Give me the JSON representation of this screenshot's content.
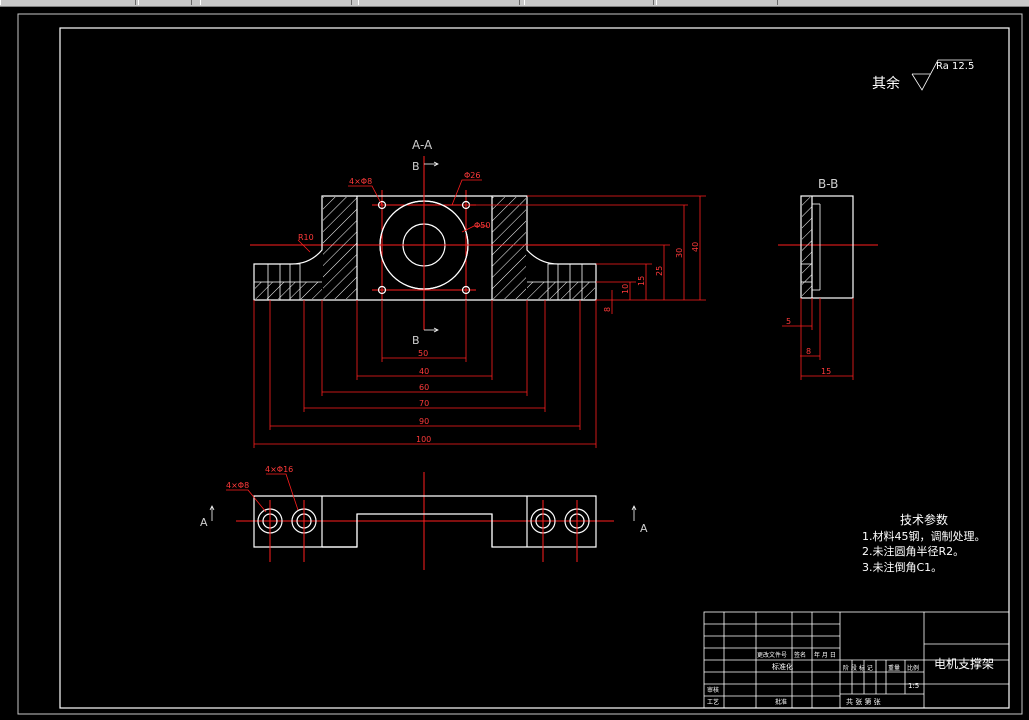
{
  "surface_finish": {
    "label": "其余",
    "ra": "Ra 12.5"
  },
  "section_labels": {
    "aa_title": "A-A",
    "bb_title": "B-B",
    "b_marker": "B",
    "a_marker": "A"
  },
  "front_dims": {
    "d1": "50",
    "d2": "40",
    "d3": "60",
    "d4": "70",
    "d5": "90",
    "d6": "100",
    "note_holes": "4×Φ8",
    "note_phi": "Φ26",
    "note_phi2": "Φ50",
    "note_r": "R10"
  },
  "right_dims": {
    "v1": "5",
    "v2": "8",
    "v3": "10",
    "v4": "15",
    "v5": "25",
    "v6": "30",
    "v7": "40"
  },
  "side_dims": {
    "s1": "5",
    "s2": "8",
    "s3": "15"
  },
  "plan_notes": {
    "n1": "4×Φ8",
    "n2": "4×Φ16"
  },
  "tech": {
    "title": "技术参数",
    "items": [
      "1.材料45钢，调制处理。",
      "2.未注圆角半径R2。",
      "3.未注倒角C1。"
    ]
  },
  "title_block": {
    "drawing_name": "电机支撑架",
    "r_change": "更改文件号",
    "r_sign": "签名",
    "r_date": "年 月 日",
    "r_standard": "标准化",
    "r_stage": "阶 段 标 记",
    "r_weight": "重量",
    "r_scale": "比例",
    "scale_val": "1:5",
    "r_review": "审核",
    "r_process": "工艺",
    "r_approve": "批准",
    "r_sheets": "共  张  第  张"
  }
}
